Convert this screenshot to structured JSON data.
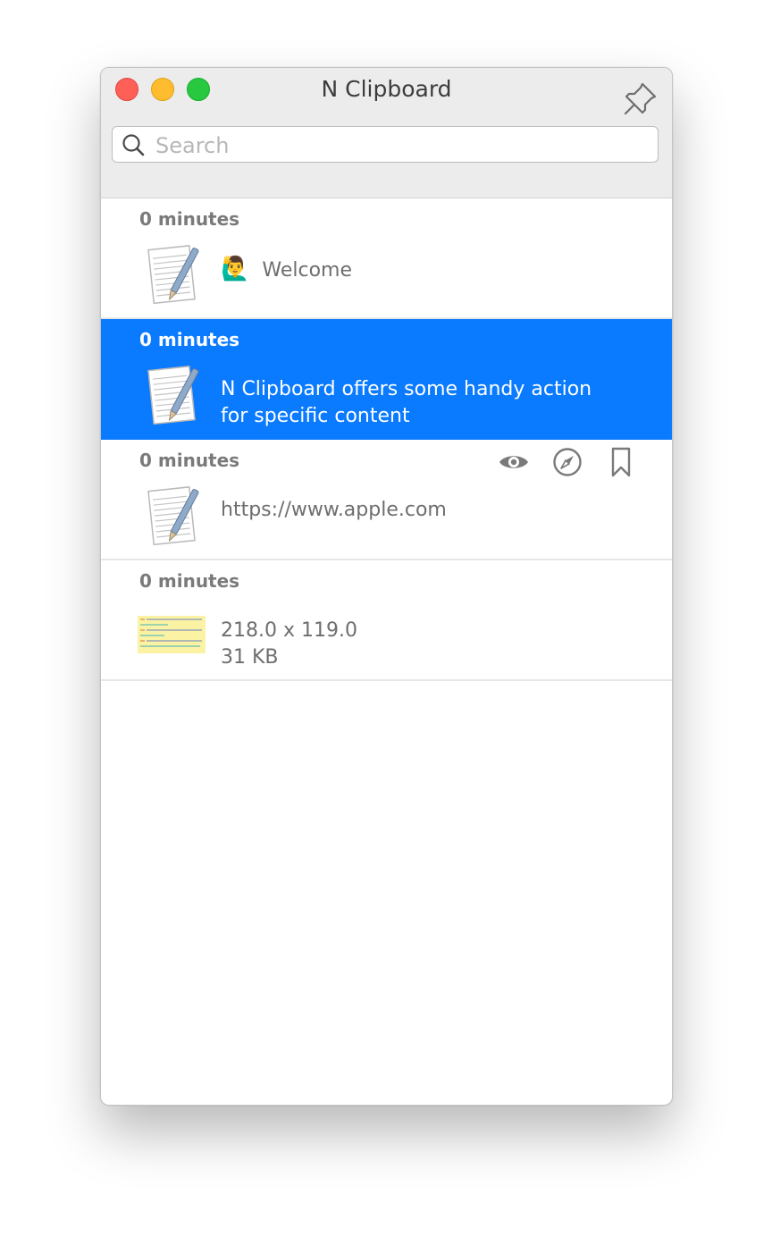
{
  "window": {
    "title": "N Clipboard"
  },
  "search": {
    "placeholder": "Search",
    "value": ""
  },
  "items": [
    {
      "time": "0 minutes",
      "emoji": "🙋‍♂️",
      "text": "Welcome"
    },
    {
      "time": "0 minutes",
      "line1": "N Clipboard offers some handy action",
      "line2": "for specific content",
      "selected": true
    },
    {
      "time": "0 minutes",
      "text": "https://www.apple.com",
      "actions": [
        "eye-icon",
        "compass-icon",
        "bookmark-icon"
      ]
    },
    {
      "time": "0 minutes",
      "line1": "218.0 x 119.0",
      "line2": "31 KB"
    }
  ],
  "colors": {
    "selected": "#0a7aff",
    "close": "#fe5f57",
    "minimize": "#febc2e",
    "zoom": "#28c840"
  }
}
